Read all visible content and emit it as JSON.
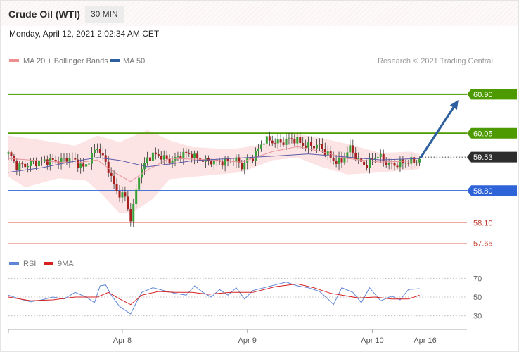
{
  "header": {
    "title": "Crude Oil (WTI)",
    "interval": "30 MIN",
    "timestamp": "Monday, April 12, 2021 2:02:34 AM CET"
  },
  "colors": {
    "green": "#4c9a00",
    "blue": "#2f64d8",
    "red": "#c0392b",
    "salmon": "#f2a8a0",
    "dark": "#2d2d2d",
    "candle_up": "#38a038",
    "candle_down": "#a81f1f",
    "bollinger_fill": "#fde4e4",
    "ma20": "#e8949c",
    "ma50": "#5a5aa8",
    "arrow": "#2e5f9e",
    "rsi": "#5f86d6",
    "rsi_ma": "#d62020"
  },
  "chart_data": [
    {
      "type": "candlestick",
      "legend": [
        {
          "label": "MA 20 + Bollinger Bands",
          "color": "#ee8f8f"
        },
        {
          "label": "MA 50",
          "color": "#2e5f9e"
        }
      ],
      "credit": "Research © 2021 Trading Central",
      "ylim": [
        57.4,
        61.42
      ],
      "x_ticks": [
        {
          "label": "Apr 8",
          "index": 41
        },
        {
          "label": "Apr 9",
          "index": 86
        },
        {
          "label": "Apr 10",
          "index": 131
        },
        {
          "label": "Apr 16",
          "index": 150
        }
      ],
      "levels": [
        {
          "label": "60.90",
          "value": 60.9,
          "kind": "resistance",
          "line_color": "#4c9a00",
          "label_bg": "#4c9a00",
          "label_fg": "#ffffff"
        },
        {
          "label": "60.05",
          "value": 60.05,
          "kind": "resistance",
          "line_color": "#4c9a00",
          "label_bg": "#4c9a00",
          "label_fg": "#ffffff"
        },
        {
          "label": "59.53",
          "value": 59.53,
          "kind": "last",
          "line_color": "#555555",
          "label_bg": "#2d2d2d",
          "label_fg": "#ffffff"
        },
        {
          "label": "58.80",
          "value": 58.8,
          "kind": "pivot",
          "line_color": "#2f64d8",
          "label_bg": "#2f64d8",
          "label_fg": "#ffffff"
        },
        {
          "label": "58.10",
          "value": 58.1,
          "kind": "support",
          "line_color": "#f2a8a0",
          "label_bg": "",
          "label_fg": "#c0392b"
        },
        {
          "label": "57.65",
          "value": 57.65,
          "kind": "support",
          "line_color": "#f2a8a0",
          "label_bg": "",
          "label_fg": "#c0392b"
        }
      ],
      "arrow": {
        "from": {
          "index": 148,
          "value": 59.53
        },
        "to": {
          "index": 162,
          "value": 60.9
        }
      },
      "close_path": [
        [
          0,
          59.6
        ],
        [
          3,
          59.28
        ],
        [
          8,
          59.45
        ],
        [
          12,
          59.38
        ],
        [
          17,
          59.5
        ],
        [
          22,
          59.46
        ],
        [
          27,
          59.35
        ],
        [
          32,
          59.7
        ],
        [
          36,
          59.3
        ],
        [
          39,
          58.8
        ],
        [
          42,
          58.6
        ],
        [
          44,
          58.15
        ],
        [
          45,
          58.45
        ],
        [
          47,
          59.2
        ],
        [
          50,
          59.5
        ],
        [
          55,
          59.55
        ],
        [
          60,
          59.48
        ],
        [
          66,
          59.62
        ],
        [
          72,
          59.38
        ],
        [
          77,
          59.48
        ],
        [
          81,
          59.45
        ],
        [
          84,
          59.3
        ],
        [
          86,
          59.5
        ],
        [
          89,
          59.62
        ],
        [
          92,
          59.85
        ],
        [
          97,
          59.9
        ],
        [
          104,
          59.86
        ],
        [
          108,
          59.82
        ],
        [
          112,
          59.72
        ],
        [
          116,
          59.55
        ],
        [
          120,
          59.42
        ],
        [
          123,
          59.68
        ],
        [
          126,
          59.5
        ],
        [
          129,
          59.38
        ],
        [
          133,
          59.52
        ],
        [
          136,
          59.45
        ],
        [
          139,
          59.38
        ],
        [
          142,
          59.35
        ],
        [
          145,
          59.45
        ],
        [
          148,
          59.53
        ]
      ],
      "bollinger_upper": [
        [
          0,
          60.0
        ],
        [
          12,
          59.9
        ],
        [
          24,
          59.78
        ],
        [
          32,
          60.0
        ],
        [
          40,
          59.86
        ],
        [
          50,
          60.12
        ],
        [
          58,
          59.9
        ],
        [
          66,
          59.75
        ],
        [
          80,
          59.7
        ],
        [
          95,
          59.84
        ],
        [
          104,
          60.03
        ],
        [
          112,
          59.95
        ],
        [
          122,
          59.82
        ],
        [
          134,
          59.62
        ],
        [
          145,
          59.65
        ],
        [
          148,
          59.6
        ]
      ],
      "bollinger_lower": [
        [
          0,
          59.1
        ],
        [
          6,
          58.87
        ],
        [
          18,
          59.07
        ],
        [
          28,
          59.02
        ],
        [
          34,
          58.7
        ],
        [
          40,
          58.3
        ],
        [
          45,
          58.33
        ],
        [
          52,
          58.62
        ],
        [
          58,
          59.05
        ],
        [
          70,
          59.12
        ],
        [
          84,
          59.2
        ],
        [
          95,
          59.46
        ],
        [
          104,
          59.52
        ],
        [
          112,
          59.33
        ],
        [
          122,
          59.15
        ],
        [
          134,
          59.2
        ],
        [
          145,
          59.25
        ],
        [
          148,
          59.27
        ]
      ],
      "ma20": [
        [
          0,
          59.5
        ],
        [
          12,
          59.45
        ],
        [
          24,
          59.4
        ],
        [
          32,
          59.47
        ],
        [
          38,
          59.2
        ],
        [
          44,
          59.0
        ],
        [
          50,
          59.25
        ],
        [
          58,
          59.5
        ],
        [
          70,
          59.48
        ],
        [
          84,
          59.42
        ],
        [
          95,
          59.65
        ],
        [
          104,
          59.76
        ],
        [
          112,
          59.66
        ],
        [
          122,
          59.5
        ],
        [
          134,
          59.42
        ],
        [
          148,
          59.45
        ]
      ],
      "ma50": [
        [
          0,
          59.2
        ],
        [
          12,
          59.3
        ],
        [
          22,
          59.42
        ],
        [
          32,
          59.52
        ],
        [
          40,
          59.46
        ],
        [
          50,
          59.32
        ],
        [
          58,
          59.38
        ],
        [
          66,
          59.45
        ],
        [
          80,
          59.5
        ],
        [
          95,
          59.55
        ],
        [
          108,
          59.6
        ],
        [
          120,
          59.54
        ],
        [
          134,
          59.47
        ],
        [
          148,
          59.5
        ]
      ]
    },
    {
      "type": "line",
      "legend": [
        {
          "label": "RSI",
          "color": "#5f86d6"
        },
        {
          "label": "9MA",
          "color": "#d62020"
        }
      ],
      "ylim": [
        20,
        80
      ],
      "y_ticks": [
        70,
        50,
        30
      ],
      "series": [
        {
          "name": "RSI",
          "values": [
            [
              0,
              52
            ],
            [
              4,
              48
            ],
            [
              8,
              45
            ],
            [
              12,
              47
            ],
            [
              16,
              50
            ],
            [
              20,
              48
            ],
            [
              24,
              55
            ],
            [
              28,
              50
            ],
            [
              31,
              44
            ],
            [
              33,
              62
            ],
            [
              35,
              63
            ],
            [
              37,
              52
            ],
            [
              40,
              40
            ],
            [
              42,
              36
            ],
            [
              44,
              32
            ],
            [
              46,
              44
            ],
            [
              48,
              55
            ],
            [
              52,
              60
            ],
            [
              56,
              57
            ],
            [
              60,
              54
            ],
            [
              64,
              52
            ],
            [
              67,
              62
            ],
            [
              70,
              55
            ],
            [
              73,
              50
            ],
            [
              76,
              58
            ],
            [
              79,
              52
            ],
            [
              82,
              60
            ],
            [
              85,
              48
            ],
            [
              88,
              57
            ],
            [
              92,
              60
            ],
            [
              96,
              63
            ],
            [
              100,
              66
            ],
            [
              104,
              62
            ],
            [
              108,
              60
            ],
            [
              112,
              56
            ],
            [
              115,
              48
            ],
            [
              117,
              42
            ],
            [
              120,
              60
            ],
            [
              124,
              55
            ],
            [
              127,
              44
            ],
            [
              130,
              60
            ],
            [
              134,
              46
            ],
            [
              138,
              51
            ],
            [
              141,
              47
            ],
            [
              144,
              58
            ],
            [
              148,
              59
            ]
          ]
        },
        {
          "name": "9MA",
          "values": [
            [
              0,
              50
            ],
            [
              8,
              46
            ],
            [
              16,
              47
            ],
            [
              24,
              50
            ],
            [
              32,
              50
            ],
            [
              36,
              55
            ],
            [
              40,
              48
            ],
            [
              44,
              42
            ],
            [
              48,
              52
            ],
            [
              54,
              56
            ],
            [
              60,
              55
            ],
            [
              66,
              55
            ],
            [
              72,
              53
            ],
            [
              80,
              55
            ],
            [
              88,
              55
            ],
            [
              96,
              61
            ],
            [
              104,
              64
            ],
            [
              110,
              60
            ],
            [
              116,
              54
            ],
            [
              120,
              52
            ],
            [
              126,
              49
            ],
            [
              132,
              50
            ],
            [
              138,
              48
            ],
            [
              144,
              48
            ],
            [
              148,
              52
            ]
          ]
        }
      ]
    }
  ]
}
